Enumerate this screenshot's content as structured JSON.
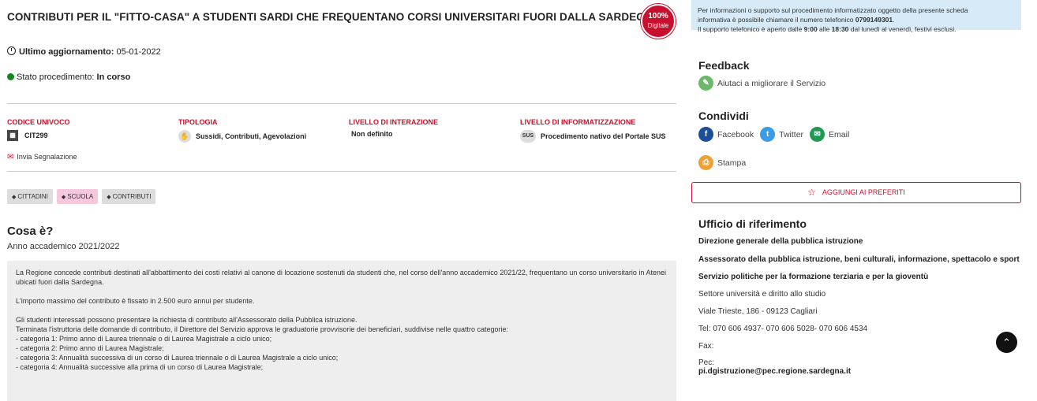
{
  "page": {
    "title": "CONTRIBUTI PER IL \"FITTO-CASA\" A STUDENTI SARDI CHE FREQUENTANO CORSI UNIVERSITARI FUORI DALLA SARDEGNA",
    "badge_top": "100%",
    "badge_bottom": "Digitale",
    "updated_label": "Ultimo aggiornamento:",
    "updated_value": "05-01-2022",
    "state_label": "Stato procedimento:",
    "state_value": "In corso"
  },
  "meta": [
    {
      "head": "CODICE UNIVOCO",
      "value": "CIT299"
    },
    {
      "head": "TIPOLOGIA",
      "value": "Sussidi, Contributi, Agevolazioni"
    },
    {
      "head": "LIVELLO DI INTERAZIONE",
      "value": "Non definito"
    },
    {
      "head": "LIVELLO DI INFORMATIZZAZIONE",
      "value": "Procedimento nativo del Portale SUS",
      "icon_text": "SUS"
    }
  ],
  "report_label": "Invia Segnalazione",
  "tags": [
    "CITTADINI",
    "SCUOLA",
    "CONTRIBUTI"
  ],
  "section": {
    "heading": "Cosa è?",
    "year": "Anno accademico 2021/2022",
    "p1": "La Regione concede contributi destinati all'abbattimento dei costi relativi al canone di locazione sostenuti da studenti che, nel corso dell'anno accademico 2021/22, frequentano un corso universitario in Atenei ubicati fuori dalla Sardegna.",
    "p2": "L'importo massimo del contributo è fissato in 2.500 euro annui per studente.",
    "p3a": "Gli studenti interessati possono presentare la richiesta di contributo all'Assessorato della Pubblica istruzione.",
    "p3b": "Terminata l'istruttoria delle domande di contributo, il Direttore del Servizio approva le graduatorie provvisorie dei beneficiari, suddivise nelle quattro categorie:",
    "c1": "- categoria 1: Primo anno di Laurea triennale o di Laurea Magistrale a ciclo unico;",
    "c2": "- categoria 2: Primo anno di Laurea Magistrale;",
    "c3": "- categoria 3: Annualità successiva di un corso di Laurea triennale o di Laurea Magistrale a ciclo unico;",
    "c4": "- categoria 4: Annualità successive alla prima di un corso di Laurea Magistrale;"
  },
  "side": {
    "info_1": "Per informazioni o supporto sul procedimento informatizzato oggetto della presente scheda",
    "info_2a": "informativa è possibile chiamare il numero telefonico ",
    "info_phone": "0799149301",
    "info_2b": ".",
    "info_3a": "Il supporto telefonico è aperto dalle ",
    "info_from": "9:00",
    "info_3b": " alle ",
    "info_to": "18:30",
    "info_3c": " dal lunedì al venerdì, festivi esclusi.",
    "feedback_heading": "Feedback",
    "feedback_link": "Aiutaci a migliorare il Servizio",
    "share_heading": "Condividi",
    "share_facebook": "Facebook",
    "share_twitter": "Twitter",
    "share_email": "Email",
    "print_label": "Stampa",
    "fav_label": "AGGIUNGI AI PREFERITI",
    "office_heading": "Ufficio di riferimento",
    "office_1": "Direzione generale della pubblica istruzione",
    "office_2": "Assessorato della pubblica istruzione, beni culturali, informazione, spettacolo e sport",
    "office_3": "Servizio politiche per la formazione terziaria e per la gioventù",
    "office_4": "Settore università e diritto allo studio",
    "office_5": "Viale Trieste, 186 - 09123 Cagliari",
    "office_6": "Tel: 070 606 4937- 070 606 5028- 070 606 4534",
    "office_7": "Fax:",
    "office_8": "Pec:",
    "office_9": "pi.dgistruzione@pec.regione.sardegna.it"
  },
  "colors": {
    "accent_red": "#c8102e",
    "info_bg": "#d6ebf7",
    "status_green": "#0a8a18"
  }
}
